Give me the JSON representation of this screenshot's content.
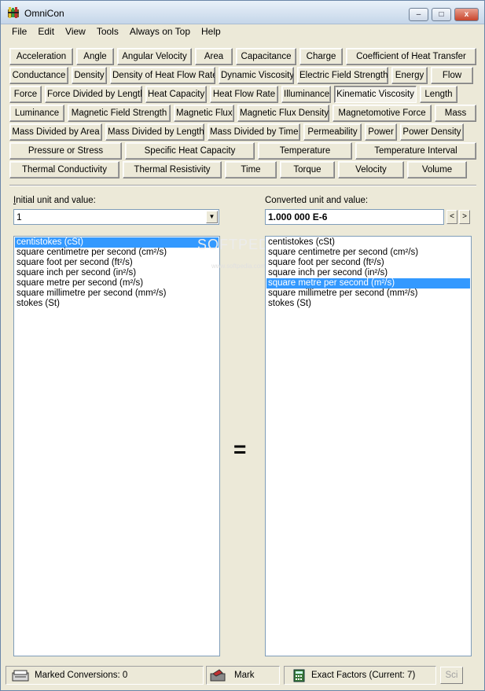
{
  "window": {
    "title": "OmniCon",
    "min": "–",
    "max": "□",
    "close": "x"
  },
  "menu": [
    "File",
    "Edit",
    "View",
    "Tools",
    "Always on Top",
    "Help"
  ],
  "categories": [
    [
      "Acceleration",
      "Angle",
      "Angular Velocity",
      "Area",
      "Capacitance",
      "Charge",
      "Coefficient of Heat Transfer"
    ],
    [
      "Conductance",
      "Density",
      "Density of Heat Flow Rate",
      "Dynamic Viscosity",
      "Electric Field Strength",
      "Energy",
      "Flow"
    ],
    [
      "Force",
      "Force Divided by Length",
      "Heat Capacity",
      "Heat Flow Rate",
      "Illuminance",
      "Kinematic Viscosity",
      "Length"
    ],
    [
      "Luminance",
      "Magnetic Field Strength",
      "Magnetic Flux",
      "Magnetic Flux Density",
      "Magnetomotive Force",
      "Mass"
    ],
    [
      "Mass Divided by Area",
      "Mass Divided by Length",
      "Mass Divided by Time",
      "Permeability",
      "Power",
      "Power Density"
    ],
    [
      "Pressure or Stress",
      "Specific Heat Capacity",
      "Temperature",
      "Temperature Interval"
    ],
    [
      "Thermal Conductivity",
      "Thermal Resistivity",
      "Time",
      "Torque",
      "Velocity",
      "Volume"
    ]
  ],
  "selected_category": "Kinematic Viscosity",
  "initial": {
    "label_prefix": "I",
    "label_rest": "nitial unit and value:",
    "value": "1",
    "units": [
      "centistokes (cSt)",
      "square centimetre per second (cm²/s)",
      "square foot per second (ft²/s)",
      "square inch per second (in²/s)",
      "square metre per second (m²/s)",
      "square millimetre per second (mm²/s)",
      "stokes (St)"
    ],
    "selected_index": 0
  },
  "converted": {
    "label": "Converted unit and value:",
    "value": "1.000 000 E-6",
    "prev": "<",
    "next": ">",
    "units": [
      "centistokes (cSt)",
      "square centimetre per second (cm²/s)",
      "square foot per second (ft²/s)",
      "square inch per second (in²/s)",
      "square metre per second (m²/s)",
      "square millimetre per second (mm²/s)",
      "stokes (St)"
    ],
    "selected_index": 4
  },
  "equals_sign": "=",
  "watermark": {
    "main": "SOFTPEDIA",
    "sub": "www.softpedia.com"
  },
  "status": {
    "marked": "Marked Conversions: 0",
    "mark": "Mark",
    "exact": "Exact Factors  (Current: 7)",
    "sci": "Sci"
  },
  "colors": {
    "selection": "#3399ff",
    "face": "#ece9d8"
  }
}
